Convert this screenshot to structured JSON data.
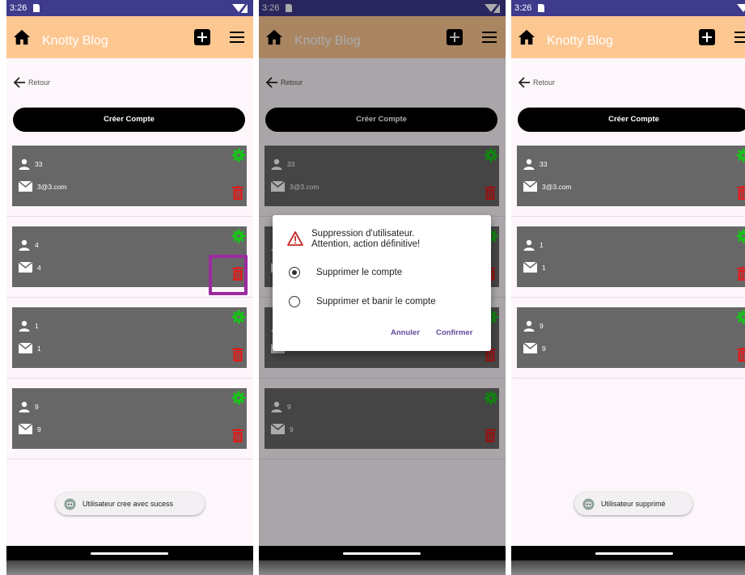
{
  "status": {
    "time": "3:26"
  },
  "app": {
    "title": "Knotty Blog"
  },
  "nav": {
    "back_label": "Retour"
  },
  "create_button": "Créer Compte",
  "colors": {
    "appbar": "#fdc792",
    "card": "#676767",
    "gear": "#18c418",
    "trash": "#e01b1b",
    "highlight": "#9c2aa0",
    "statusbar": "#3e3a8c"
  },
  "screens": [
    {
      "users": [
        {
          "name": "33",
          "email": "3@3.com"
        },
        {
          "name": "4",
          "email": "4"
        },
        {
          "name": "1",
          "email": "1"
        },
        {
          "name": "9",
          "email": "9"
        }
      ],
      "toast": "Utilisateur cree avec sucess"
    },
    {
      "users": [
        {
          "name": "33",
          "email": "3@3.com"
        },
        {
          "name": "4",
          "email": "4"
        },
        {
          "name": "1",
          "email": "1"
        },
        {
          "name": "9",
          "email": "9"
        }
      ]
    },
    {
      "users": [
        {
          "name": "33",
          "email": "3@3.com"
        },
        {
          "name": "1",
          "email": "1"
        },
        {
          "name": "9",
          "email": "9"
        }
      ],
      "toast": "Utilisateur supprimé"
    }
  ],
  "dialog": {
    "title_line1": "Suppression d'utilisateur.",
    "title_line2": "Attention, action définitive!",
    "options": [
      {
        "label": "Supprimer le compte",
        "selected": true
      },
      {
        "label": "Supprimer et banir le compte",
        "selected": false
      }
    ],
    "cancel": "Annuler",
    "confirm": "Confirmer"
  },
  "icons": {
    "home": "home-icon",
    "add": "add-square-icon",
    "menu": "hamburger-menu-icon",
    "back": "arrow-left-icon",
    "person": "person-icon",
    "mail": "mail-icon",
    "gear": "gear-icon",
    "trash": "trash-icon",
    "warning": "warning-icon",
    "toast": "robot-icon"
  }
}
